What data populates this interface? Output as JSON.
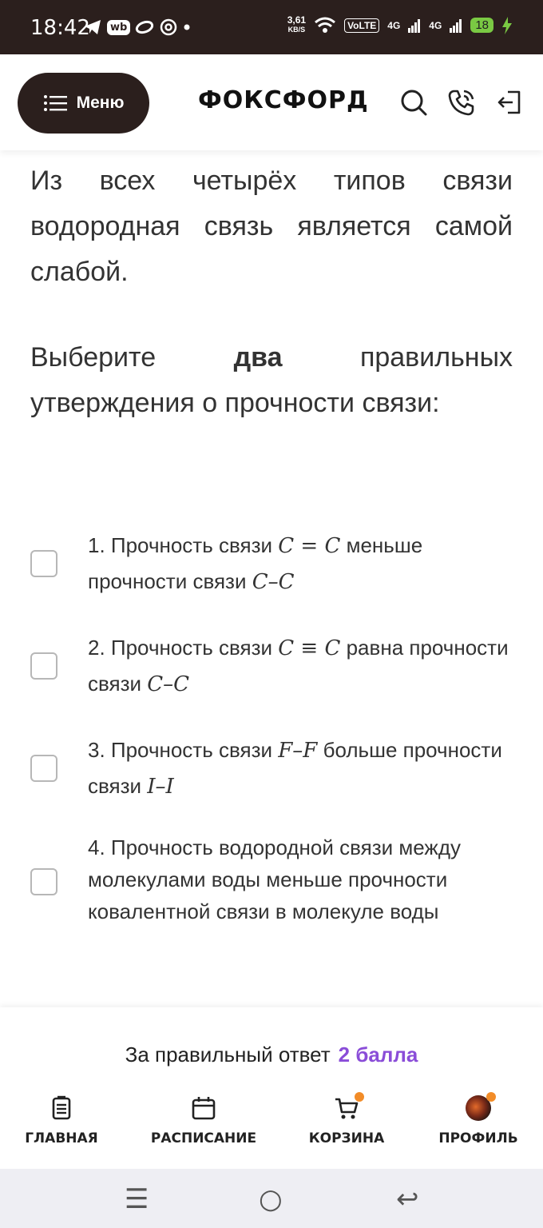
{
  "status_bar": {
    "time": "18:42",
    "speed": "3,61",
    "speed_unit": "KB/S",
    "volte": "VoLTE",
    "net1": "4G",
    "net2": "4G",
    "battery": "18"
  },
  "header": {
    "menu_label": "Меню",
    "logo": "ФОКСФОРД"
  },
  "content": {
    "para1": "Из всех четырёх типов связи водородная связь является самой слабой.",
    "para2_prefix": "Выберите",
    "para2_bold": "два",
    "para2_suffix": "правильных утверждения о прочности связи:"
  },
  "options": [
    {
      "prefix": "1. Прочность связи ",
      "math1": "C = C",
      "middle": " меньше прочности связи ",
      "math2": "C–C",
      "suffix": ""
    },
    {
      "prefix": "2. Прочность связи ",
      "math1": "C ≡ C",
      "middle": " равна прочности связи ",
      "math2": "C–C",
      "suffix": ""
    },
    {
      "prefix": "3. Прочность связи ",
      "math1": "F–F",
      "middle": " больше прочности связи ",
      "math2": "I–I",
      "suffix": ""
    },
    {
      "prefix": "4. Прочность водородной связи между молекулами воды меньше прочности ковалентной связи в молекуле воды",
      "math1": "",
      "middle": "",
      "math2": "",
      "suffix": ""
    }
  ],
  "points": {
    "label": "За правильный ответ",
    "value": "2 балла"
  },
  "bottom_nav": [
    {
      "label": "ГЛАВНАЯ",
      "icon": "home-doc-icon"
    },
    {
      "label": "РАСПИСАНИЕ",
      "icon": "calendar-icon"
    },
    {
      "label": "КОРЗИНА",
      "icon": "cart-icon"
    },
    {
      "label": "ПРОФИЛЬ",
      "icon": "avatar"
    }
  ],
  "colors": {
    "dark": "#2b1f1d",
    "accent_purple": "#8a4dd8",
    "badge_orange": "#f28c28"
  }
}
